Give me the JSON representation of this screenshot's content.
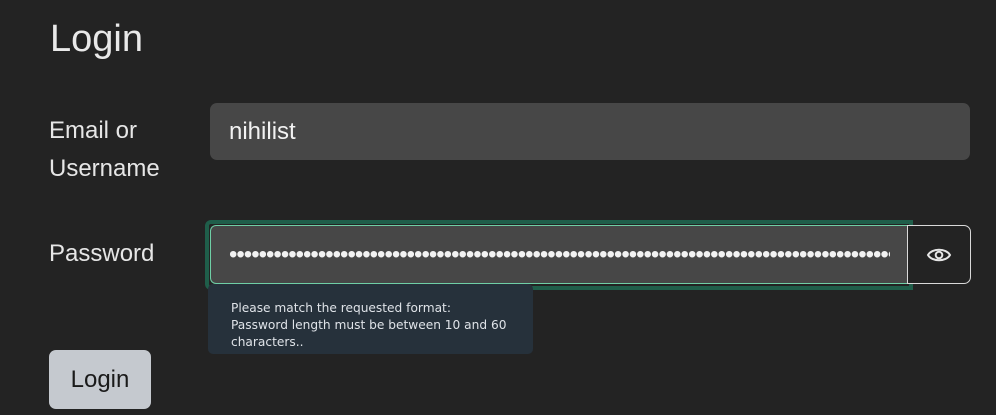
{
  "page": {
    "title": "Login"
  },
  "form": {
    "username_label": "Email or Username",
    "username_value": "nihilist",
    "password_label": "Password",
    "password_mask": "••••••••••••••••••••••••••••••••••••••••••••••••••••••••••••••••••••••••••••••••••••••••••",
    "show_password_icon": "eye-icon",
    "validation_message": "Please match the requested format: Password length must be between 10 and 60 characters..",
    "submit_label": "Login"
  },
  "colors": {
    "background": "#232323",
    "input_background": "#474747",
    "focus_outline": "#1f5e4a",
    "tooltip_background": "#26313b",
    "button_background": "#c5c9cf"
  }
}
